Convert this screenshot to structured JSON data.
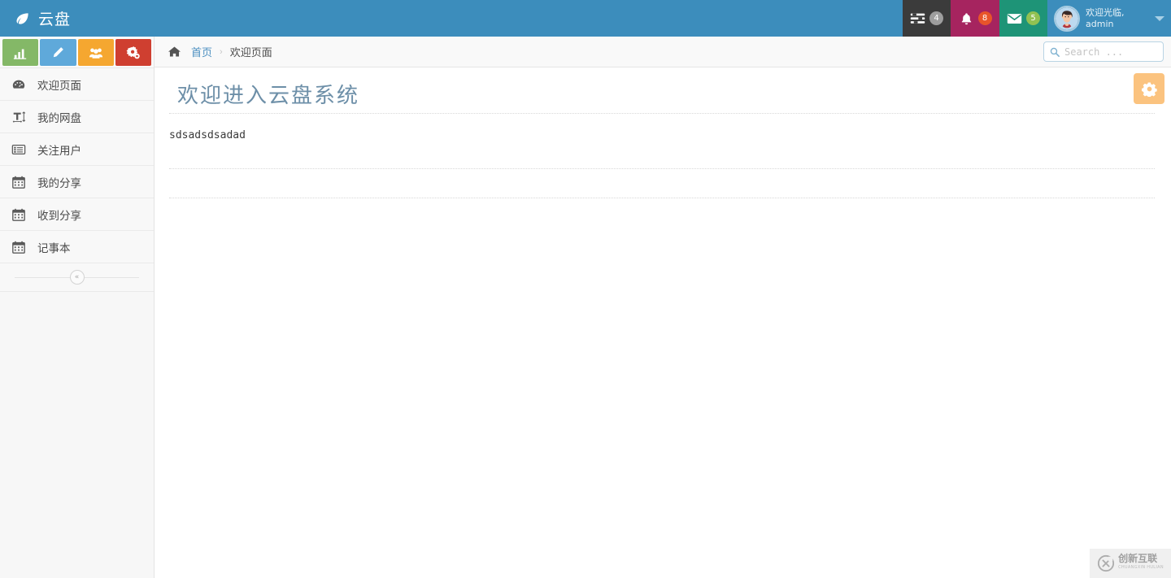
{
  "header": {
    "logo_text": "云盘",
    "logo_icon": "leaf-icon",
    "items": [
      {
        "icon": "tasks-icon",
        "badge": "4",
        "badge_color": "#9e9e9e"
      },
      {
        "icon": "bell-icon",
        "badge": "8",
        "badge_color": "#e8542a"
      },
      {
        "icon": "envelope-icon",
        "badge": "5",
        "badge_color": "#91c152"
      }
    ],
    "user": {
      "greeting": "欢迎光临,",
      "name": "admin",
      "avatar": "user-avatar",
      "caret": "chevron-down-icon"
    }
  },
  "sidebar": {
    "quick_actions": [
      {
        "icon": "bar-chart-icon",
        "color": "#84b867"
      },
      {
        "icon": "pencil-icon",
        "color": "#5fa9da"
      },
      {
        "icon": "group-icon",
        "color": "#f5a730"
      },
      {
        "icon": "cogs-icon",
        "color": "#cf3f30"
      }
    ],
    "items": [
      {
        "label": "欢迎页面",
        "icon": "dashboard-icon"
      },
      {
        "label": "我的网盘",
        "icon": "text-height-icon"
      },
      {
        "label": "关注用户",
        "icon": "list-alt-icon"
      },
      {
        "label": "我的分享",
        "icon": "calendar-icon"
      },
      {
        "label": "收到分享",
        "icon": "calendar-icon"
      },
      {
        "label": "记事本",
        "icon": "calendar-icon"
      }
    ],
    "collapse_label": "«"
  },
  "breadcrumb": {
    "home_icon": "home-icon",
    "home_label": "首页",
    "separator": "›",
    "current": "欢迎页面"
  },
  "search": {
    "placeholder": "Search ...",
    "value": "",
    "icon": "search-icon"
  },
  "main": {
    "title": "欢迎进入云盘系统",
    "gear_icon": "gear-icon",
    "body_text": "sdsadsdsadad"
  },
  "watermark": {
    "cn": "创新互联",
    "en": "CHUANGXIN HULIAN"
  },
  "colors": {
    "brand": "#3c8dbc",
    "title": "#6d8fa8",
    "link": "#4b8fc0",
    "gear_bg": "#fbc37f"
  }
}
